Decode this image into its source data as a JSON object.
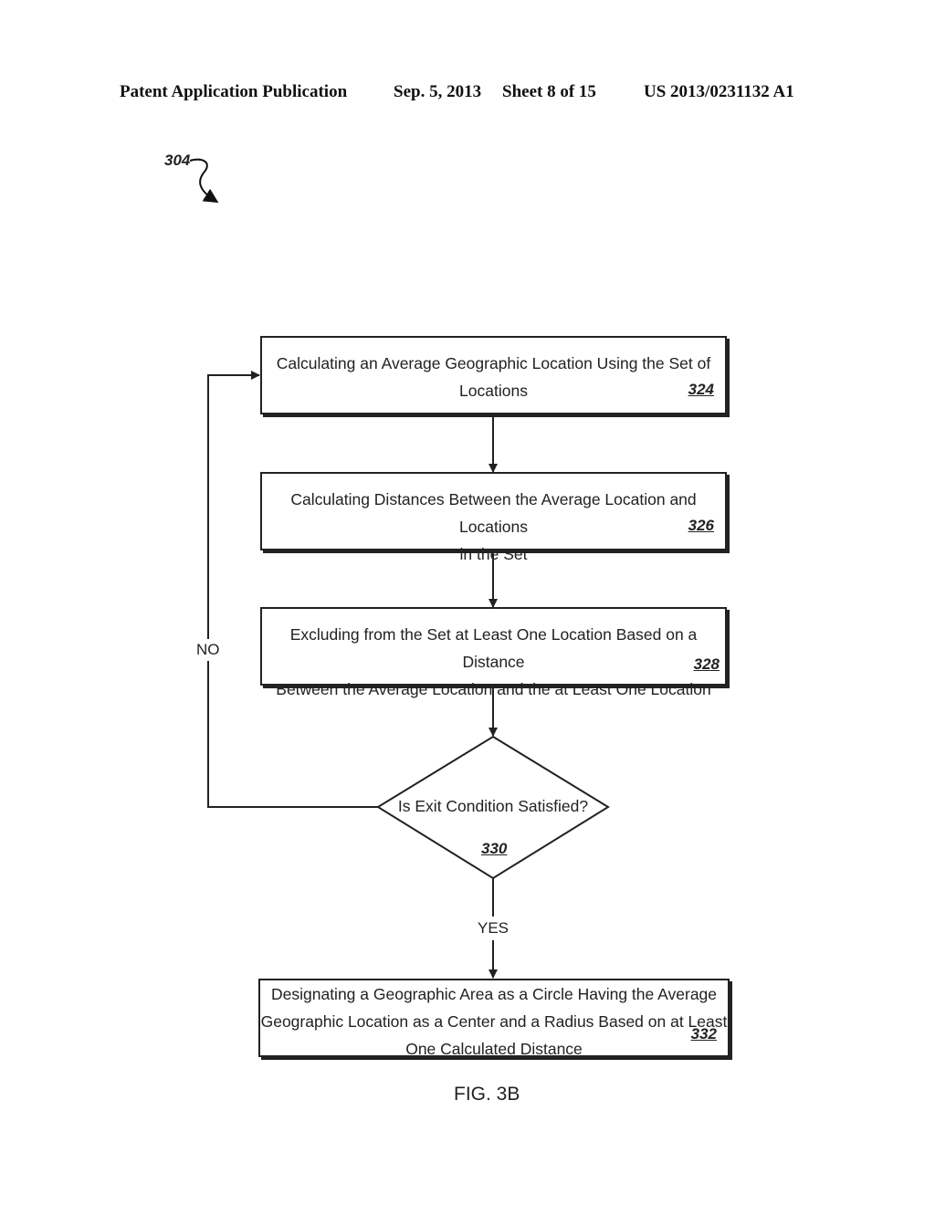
{
  "header": {
    "publication": "Patent Application Publication",
    "date": "Sep. 5, 2013",
    "sheet": "Sheet 8 of 15",
    "number": "US 2013/0231132 A1"
  },
  "figure_ref": "304",
  "steps": [
    {
      "id": "324",
      "lines": [
        "Calculating an Average Geographic Location Using the Set of",
        "Locations"
      ]
    },
    {
      "id": "326",
      "lines": [
        "Calculating Distances Between the Average Location and Locations",
        "in the Set"
      ]
    },
    {
      "id": "328",
      "lines": [
        "Excluding from the Set at Least One Location Based on a Distance",
        "Between the Average Location and the at Least One Location"
      ]
    },
    {
      "id": "332",
      "lines": [
        "Designating a Geographic Area as a Circle Having the Average",
        "Geographic Location as a Center and a Radius Based on at Least",
        "One Calculated Distance"
      ]
    }
  ],
  "decision": {
    "id": "330",
    "text": "Is Exit Condition Satisfied?"
  },
  "branches": {
    "no": "NO",
    "yes": "YES"
  },
  "caption": "FIG. 3B"
}
